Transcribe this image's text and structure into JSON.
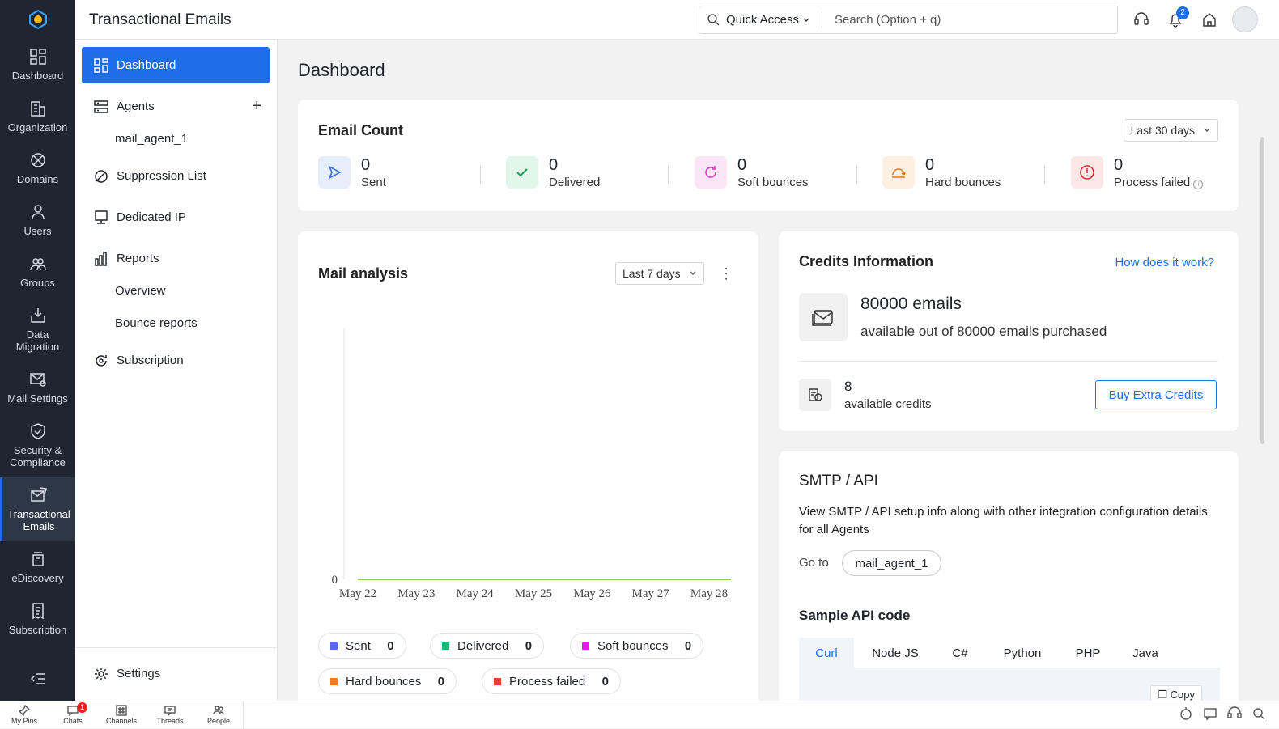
{
  "app": {
    "title": "Transactional Emails"
  },
  "rail": {
    "items": [
      {
        "label": "Dashboard",
        "icon": "grid-icon"
      },
      {
        "label": "Organization",
        "icon": "building-icon"
      },
      {
        "label": "Domains",
        "icon": "globe-icon"
      },
      {
        "label": "Users",
        "icon": "user-icon"
      },
      {
        "label": "Groups",
        "icon": "group-icon"
      },
      {
        "label": "Data Migration",
        "icon": "download-tray-icon"
      },
      {
        "label": "Mail Settings",
        "icon": "mail-gear-icon"
      },
      {
        "label": "Security & Compliance",
        "icon": "shield-check-icon"
      },
      {
        "label": "Transactional Emails",
        "icon": "mail-send-icon"
      },
      {
        "label": "eDiscovery",
        "icon": "archive-jar-icon"
      },
      {
        "label": "Subscription",
        "icon": "receipt-icon"
      }
    ]
  },
  "topbar": {
    "quick_access": "Quick Access",
    "search_placeholder": "Search (Option + q)",
    "notification_count": "2"
  },
  "subnav": {
    "dashboard": "Dashboard",
    "agents": "Agents",
    "agent_1": "mail_agent_1",
    "suppression": "Suppression List",
    "dedicated_ip": "Dedicated IP",
    "reports": "Reports",
    "overview": "Overview",
    "bounce_reports": "Bounce reports",
    "subscription": "Subscription",
    "settings": "Settings"
  },
  "main": {
    "page_title": "Dashboard",
    "email_count": {
      "title": "Email Count",
      "range": "Last 30 days",
      "stats": [
        {
          "value": "0",
          "label": "Sent",
          "color": "#3d6fe0",
          "bg": "#e6eefc"
        },
        {
          "value": "0",
          "label": "Delivered",
          "color": "#1aa05a",
          "bg": "#e2f6ea"
        },
        {
          "value": "0",
          "label": "Soft bounces",
          "color": "#d63ac8",
          "bg": "#fbe6f8"
        },
        {
          "value": "0",
          "label": "Hard bounces",
          "color": "#e27a1c",
          "bg": "#fdf0e2"
        },
        {
          "value": "0",
          "label": "Process failed",
          "color": "#d93030",
          "bg": "#fce6e6"
        }
      ]
    },
    "mail_analysis": {
      "title": "Mail analysis",
      "range": "Last 7 days",
      "legend": [
        {
          "label": "Sent",
          "value": "0",
          "color": "#5a6be8"
        },
        {
          "label": "Delivered",
          "value": "0",
          "color": "#22b573"
        },
        {
          "label": "Soft bounces",
          "value": "0",
          "color": "#e01ee0"
        },
        {
          "label": "Hard bounces",
          "value": "0",
          "color": "#f07a20"
        },
        {
          "label": "Process failed",
          "value": "0",
          "color": "#e8402a"
        }
      ]
    },
    "credits": {
      "title": "Credits Information",
      "help_link": "How does it work?",
      "emails_amount": "80000 emails",
      "emails_desc": "available out of 80000 emails purchased",
      "credits_amount": "8",
      "credits_desc": "available credits",
      "buy_button": "Buy Extra Credits"
    },
    "smtp": {
      "title": "SMTP / API",
      "desc_line1": "View SMTP / API setup info along with other integration configuration details",
      "desc_line2": "for all Agents",
      "goto_label": "Go to",
      "goto_chip": "mail_agent_1",
      "sample_title": "Sample API code",
      "tabs": [
        "Curl",
        "Node JS",
        "C#",
        "Python",
        "PHP",
        "Java"
      ],
      "copy_label": "Copy"
    }
  },
  "chart_data": {
    "type": "line",
    "x": [
      "May 22",
      "May 23",
      "May 24",
      "May 25",
      "May 26",
      "May 27",
      "May 28"
    ],
    "series": [
      {
        "name": "Sent",
        "values": [
          0,
          0,
          0,
          0,
          0,
          0,
          0
        ]
      },
      {
        "name": "Delivered",
        "values": [
          0,
          0,
          0,
          0,
          0,
          0,
          0
        ]
      },
      {
        "name": "Soft bounces",
        "values": [
          0,
          0,
          0,
          0,
          0,
          0,
          0
        ]
      },
      {
        "name": "Hard bounces",
        "values": [
          0,
          0,
          0,
          0,
          0,
          0,
          0
        ]
      },
      {
        "name": "Process failed",
        "values": [
          0,
          0,
          0,
          0,
          0,
          0,
          0
        ]
      }
    ],
    "y_ticks": [
      "0"
    ],
    "line_color": "#8fd14f"
  },
  "bottombar": {
    "items": [
      {
        "label": "My Pins",
        "icon": "pin-icon"
      },
      {
        "label": "Chats",
        "icon": "chat-icon",
        "badge": "1"
      },
      {
        "label": "Channels",
        "icon": "hash-icon"
      },
      {
        "label": "Threads",
        "icon": "thread-icon"
      },
      {
        "label": "People",
        "icon": "people-icon"
      }
    ]
  }
}
